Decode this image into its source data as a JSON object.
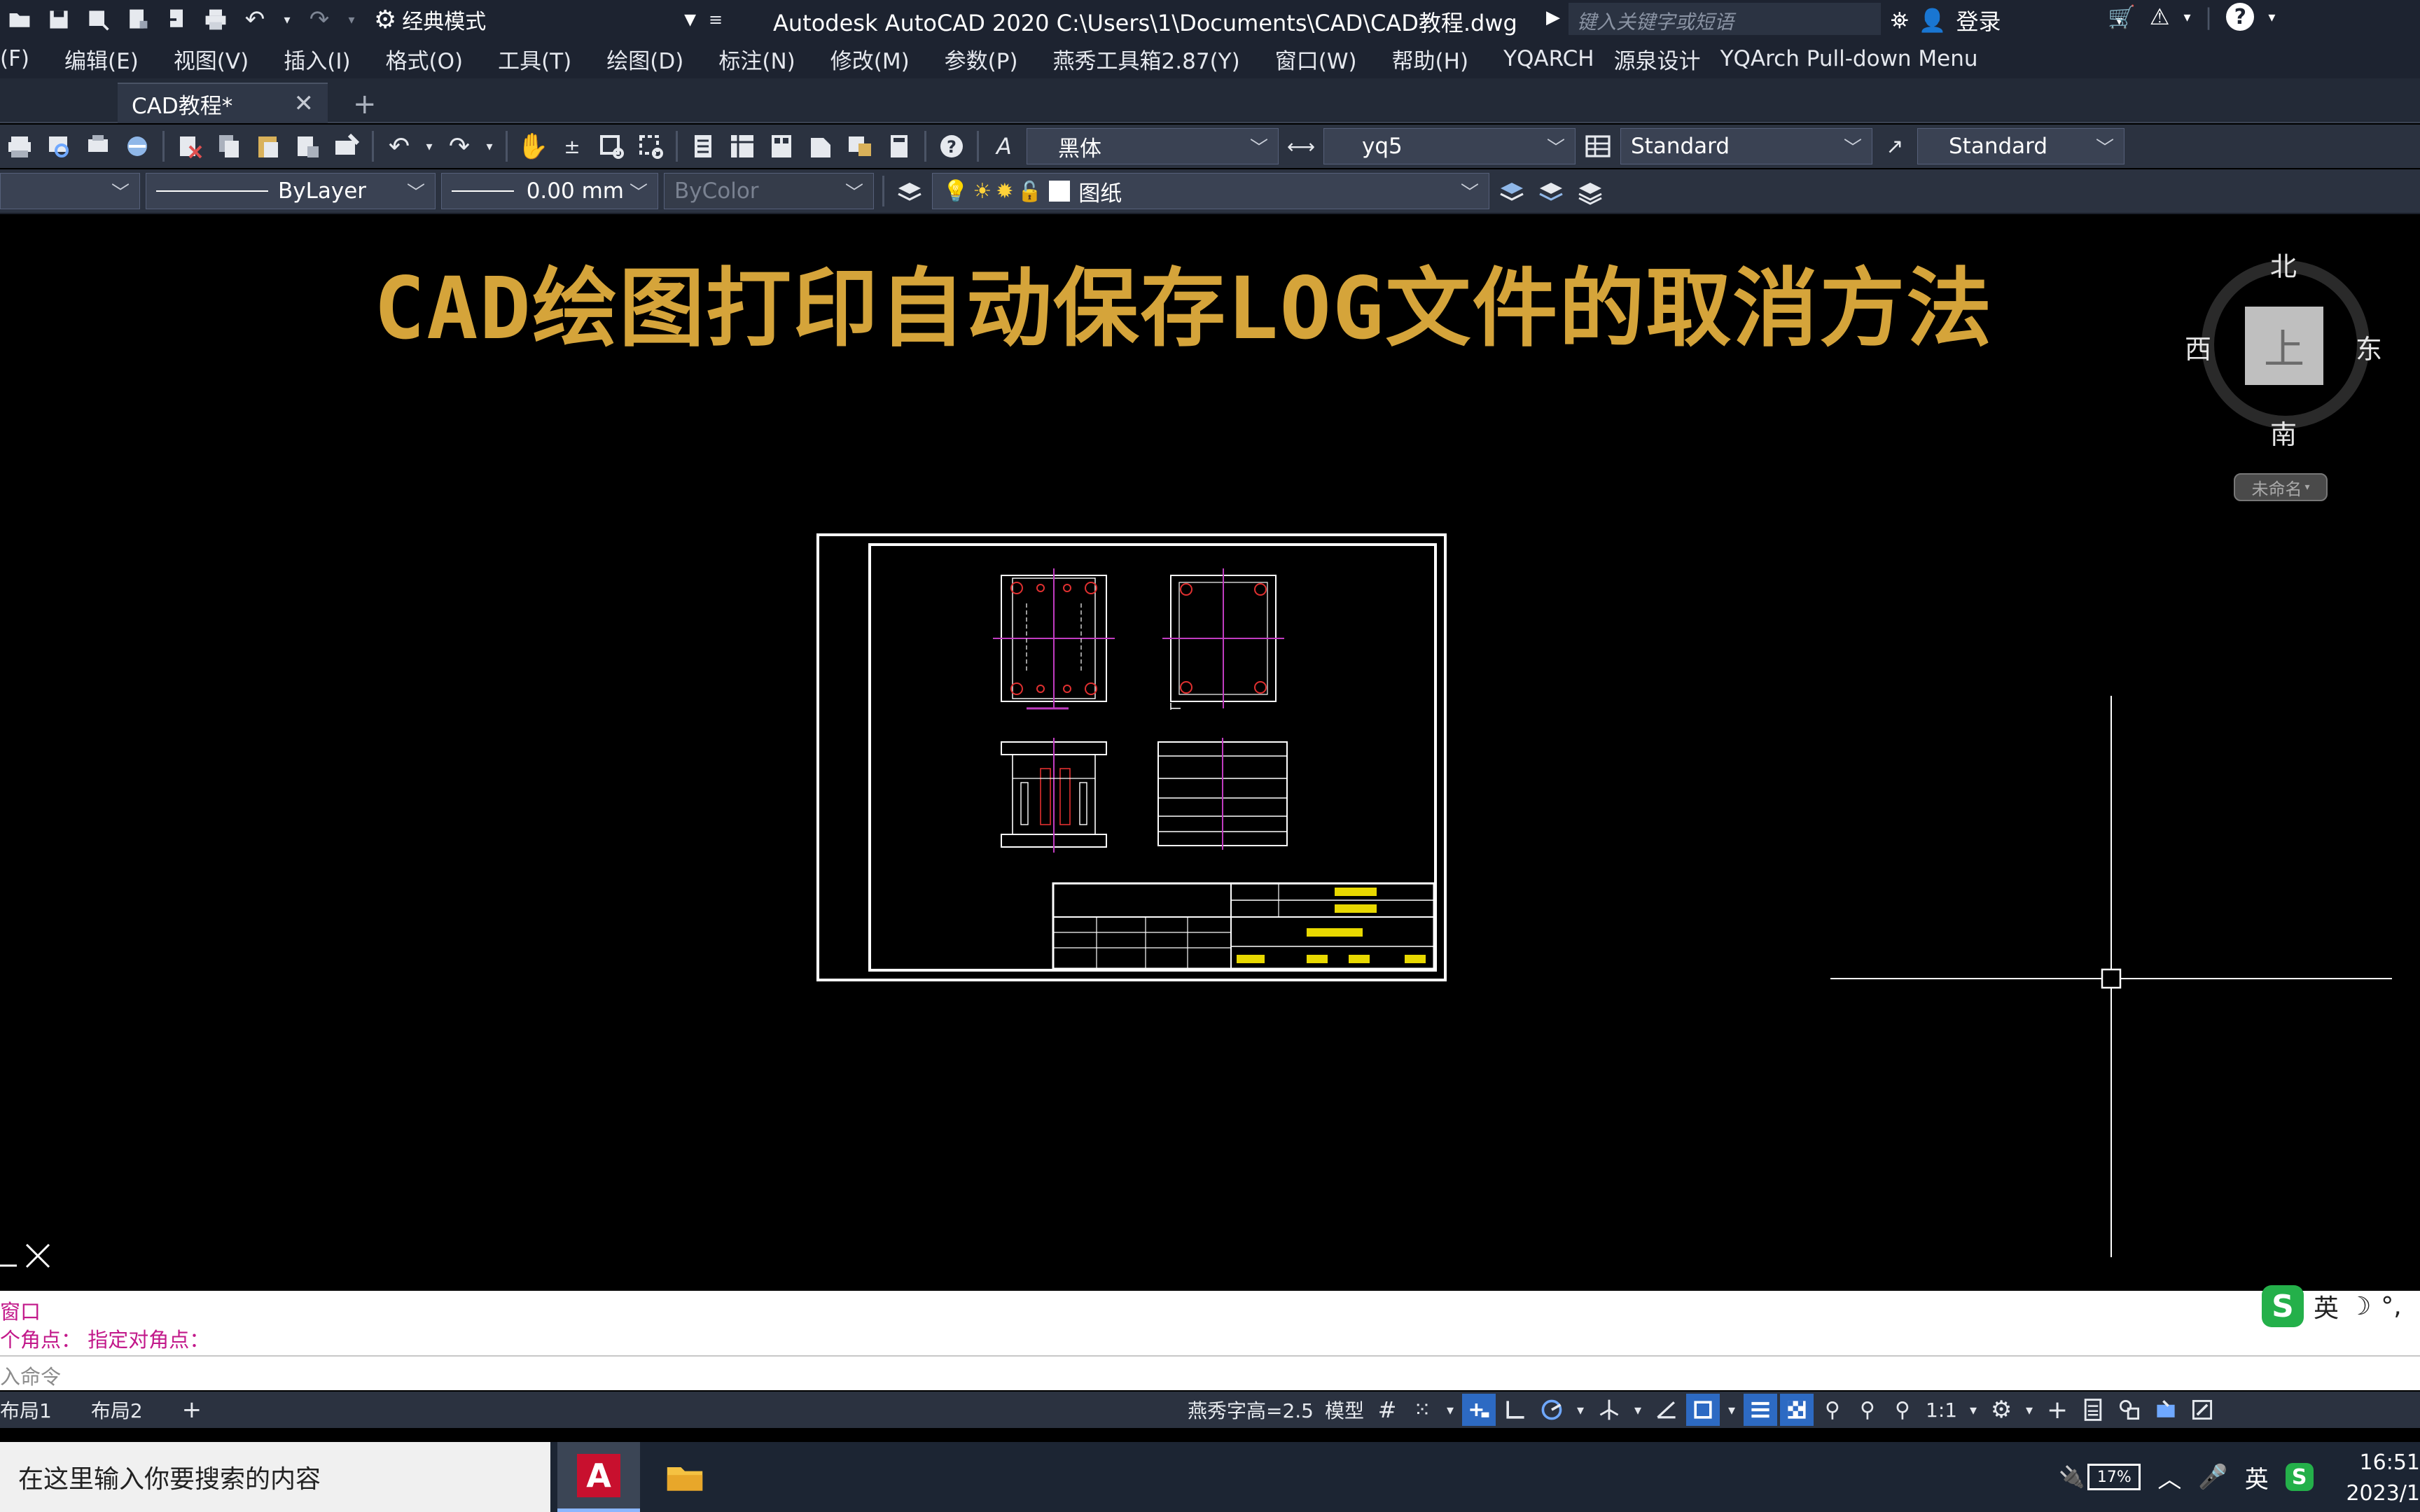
{
  "titlebar": {
    "workspace": "经典模式",
    "app_title": "Autodesk AutoCAD 2020    C:\\Users\\1\\Documents\\CAD\\CAD教程.dwg",
    "search_placeholder": "键入关键字或短语",
    "signin_label": "登录"
  },
  "menu": [
    "(F)",
    "编辑(E)",
    "视图(V)",
    "插入(I)",
    "格式(O)",
    "工具(T)",
    "绘图(D)",
    "标注(N)",
    "修改(M)",
    "参数(P)",
    "燕秀工具箱2.87(Y)",
    "窗口(W)",
    "帮助(H)",
    "YQARCH",
    "源泉设计",
    "YQArch Pull-down Menu"
  ],
  "tabs": {
    "document": "CAD教程*",
    "close": "✕",
    "new": "+"
  },
  "toolbar1": {
    "text_font": "黑体",
    "dim_style": "yq5",
    "table_style": "Standard",
    "multileader_style": "Standard"
  },
  "toolbar2": {
    "linetype": "ByLayer",
    "lineweight": "0.00 mm",
    "plotstyle": "ByColor",
    "layer": "图纸"
  },
  "drawing": {
    "overlay_title": "CAD绘图打印自动保存LOG文件的取消方法"
  },
  "viewcube": {
    "north": "北",
    "south": "南",
    "east": "东",
    "west": "西",
    "face": "上",
    "named_view": "未命名"
  },
  "command": {
    "history": [
      "窗口",
      "个角点： 指定对角点："
    ],
    "input_placeholder": "入命令"
  },
  "ime": {
    "lang": "英"
  },
  "statusbar": {
    "layout_tabs": [
      "布局1",
      "布局2"
    ],
    "add_layout": "+",
    "font_height": "燕秀字高=2.5",
    "space": "模型",
    "scale": "1:1"
  },
  "taskbar": {
    "search_placeholder": "在这里输入你要搜索的内容",
    "app_letter": "A",
    "battery": "17%",
    "ime_lang": "英",
    "time": "16:51",
    "date": "2023/1"
  }
}
